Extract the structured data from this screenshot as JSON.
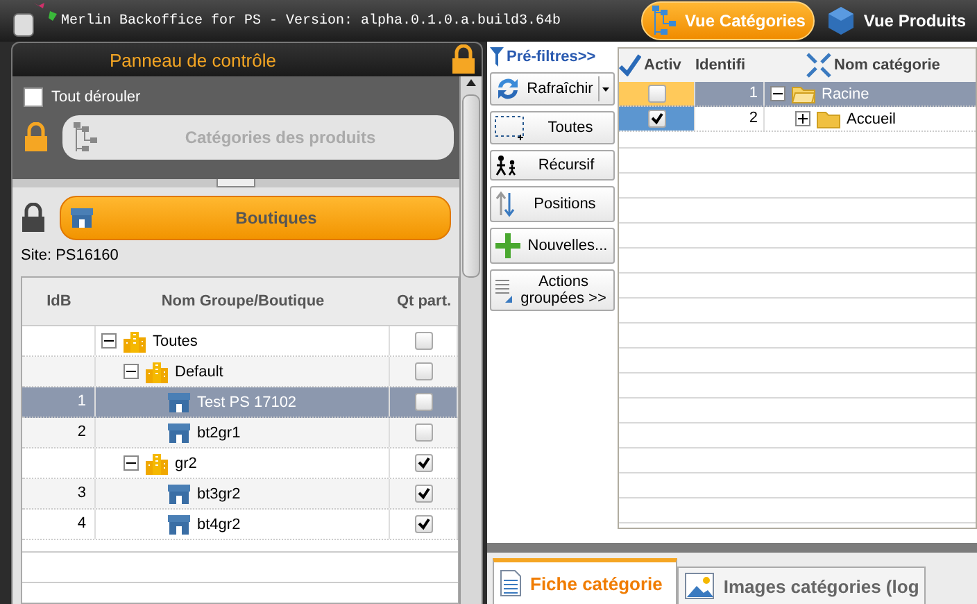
{
  "window": {
    "title": "Merlin Backoffice for PS  -  Version:  alpha.0.1.0.a.build3.64b"
  },
  "views": [
    {
      "label": "Vue Catégories",
      "kind": "tree",
      "selected": true
    },
    {
      "label": "Vue Produits",
      "kind": "cube",
      "selected": false
    }
  ],
  "control_panel": {
    "title": "Panneau de contrôle",
    "expand_all": {
      "label": "Tout dérouler",
      "checked": false
    },
    "categories_button": {
      "label": "Catégories des produits",
      "disabled": true
    },
    "shops_button": {
      "label": "Boutiques",
      "disabled": false
    },
    "site": "Site: PS16160",
    "columns": [
      "IdB",
      "Nom Groupe/Boutique",
      "Qt part."
    ],
    "rows": [
      {
        "kind": "group",
        "name": "Toutes",
        "checked": false,
        "selected": false,
        "expanded": true,
        "children": [
          {
            "kind": "group",
            "name": "Default",
            "checked": false,
            "selected": false,
            "expanded": true,
            "children": [
              {
                "kind": "shop",
                "idb": "1",
                "name": "Test PS 17102",
                "checked": false,
                "selected": true
              },
              {
                "kind": "shop",
                "idb": "2",
                "name": "bt2gr1",
                "checked": false,
                "selected": false
              }
            ]
          },
          {
            "kind": "group",
            "name": "gr2",
            "checked": true,
            "selected": false,
            "expanded": true,
            "children": [
              {
                "kind": "shop",
                "idb": "3",
                "name": "bt3gr2",
                "checked": true,
                "selected": false
              },
              {
                "kind": "shop",
                "idb": "4",
                "name": "bt4gr2",
                "checked": true,
                "selected": false
              }
            ]
          }
        ]
      }
    ]
  },
  "prefilters": "Pré-filtres>>",
  "tools": [
    {
      "kind": "refresh",
      "label": "Rafraîchir"
    },
    {
      "kind": "select",
      "label": "Toutes"
    },
    {
      "kind": "recursive",
      "label": "Récursif"
    },
    {
      "kind": "positions",
      "label": "Positions"
    },
    {
      "kind": "add",
      "label": "Nouvelles..."
    },
    {
      "kind": "actions",
      "label": "Actions groupées >>"
    }
  ],
  "categories": {
    "columns": [
      "Activ",
      "Identifi",
      "Nom catégorie"
    ],
    "rows": [
      {
        "id": "1",
        "name": "Racine",
        "active": false,
        "selected": true,
        "current": false,
        "expanded": true,
        "children": [
          {
            "id": "2",
            "name": "Accueil",
            "active": true,
            "selected": false,
            "current": true,
            "expanded": false
          }
        ]
      }
    ]
  },
  "tabs": [
    {
      "label": "Fiche catégorie",
      "kind": "sheet",
      "selected": true
    },
    {
      "label": "Images catégories (log",
      "kind": "image",
      "selected": false
    }
  ]
}
